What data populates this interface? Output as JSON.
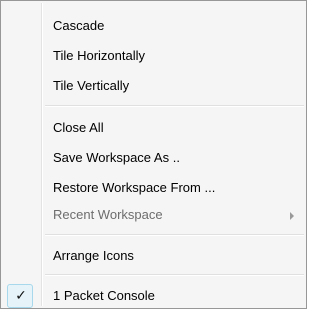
{
  "menu": {
    "items": [
      {
        "label": "Cascade",
        "enabled": true
      },
      {
        "label": "Tile Horizontally",
        "enabled": true
      },
      {
        "label": "Tile Vertically",
        "enabled": true
      },
      {
        "label": "Close All",
        "enabled": true
      },
      {
        "label": "Save Workspace As ..",
        "enabled": true
      },
      {
        "label": "Restore Workspace From ...",
        "enabled": true
      },
      {
        "label": "Recent Workspace",
        "enabled": false,
        "has_submenu": true
      },
      {
        "label": "Arrange Icons",
        "enabled": true
      },
      {
        "label": "1 Packet Console",
        "enabled": true,
        "checked": true
      }
    ],
    "check_glyph": "✓",
    "colors": {
      "background": "#f5f5f5",
      "border": "#979797",
      "text": "#000000",
      "disabled_text": "#6d6d6d",
      "check_highlight": "#e6f4fa"
    }
  }
}
